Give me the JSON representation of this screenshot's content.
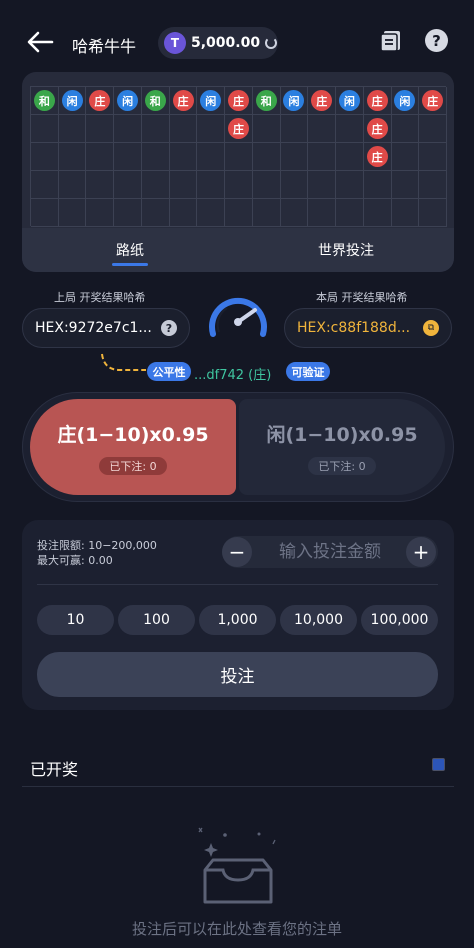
{
  "header": {
    "title": "哈希牛牛",
    "balance": "5,000.00",
    "coin_icon": "T"
  },
  "road": {
    "beads": [
      {
        "col": 0,
        "row": 0,
        "label": "和",
        "type": "tie"
      },
      {
        "col": 1,
        "row": 0,
        "label": "闲",
        "type": "player"
      },
      {
        "col": 2,
        "row": 0,
        "label": "庄",
        "type": "banker"
      },
      {
        "col": 3,
        "row": 0,
        "label": "闲",
        "type": "player"
      },
      {
        "col": 4,
        "row": 0,
        "label": "和",
        "type": "tie"
      },
      {
        "col": 5,
        "row": 0,
        "label": "庄",
        "type": "banker"
      },
      {
        "col": 6,
        "row": 0,
        "label": "闲",
        "type": "player"
      },
      {
        "col": 7,
        "row": 0,
        "label": "庄",
        "type": "banker"
      },
      {
        "col": 7,
        "row": 1,
        "label": "庄",
        "type": "banker"
      },
      {
        "col": 8,
        "row": 0,
        "label": "和",
        "type": "tie"
      },
      {
        "col": 9,
        "row": 0,
        "label": "闲",
        "type": "player"
      },
      {
        "col": 10,
        "row": 0,
        "label": "庄",
        "type": "banker"
      },
      {
        "col": 11,
        "row": 0,
        "label": "闲",
        "type": "player"
      },
      {
        "col": 12,
        "row": 0,
        "label": "庄",
        "type": "banker"
      },
      {
        "col": 12,
        "row": 1,
        "label": "庄",
        "type": "banker"
      },
      {
        "col": 12,
        "row": 2,
        "label": "庄",
        "type": "banker"
      },
      {
        "col": 13,
        "row": 0,
        "label": "闲",
        "type": "player"
      },
      {
        "col": 14,
        "row": 0,
        "label": "庄",
        "type": "banker"
      }
    ],
    "tabs": [
      "路纸",
      "世界投注"
    ]
  },
  "hash": {
    "prev_label": "上局 开奖结果哈希",
    "prev_value": "HEX:9272e7c1...",
    "cur_label": "本局 开奖结果哈希",
    "cur_value": "HEX:c88f188d...",
    "fair_badge": "公平性",
    "tail": "...df742 (庄)",
    "verify_badge": "可验证"
  },
  "bets": {
    "banker_label": "庄(1−10)x0.95",
    "banker_placed": "已下注: 0",
    "player_label": "闲(1−10)x0.95",
    "player_placed": "已下注: 0"
  },
  "panel": {
    "limit_line": "投注限额: 10−200,000",
    "max_win_line": "最大可赢: 0.00",
    "amount_placeholder": "输入投注金额",
    "minus": "−",
    "plus": "+",
    "chips": [
      "10",
      "100",
      "1,000",
      "10,000",
      "100,000"
    ],
    "submit": "投注"
  },
  "history": {
    "title": "已开奖",
    "empty_text": "投注后可以在此处查看您的注单"
  }
}
